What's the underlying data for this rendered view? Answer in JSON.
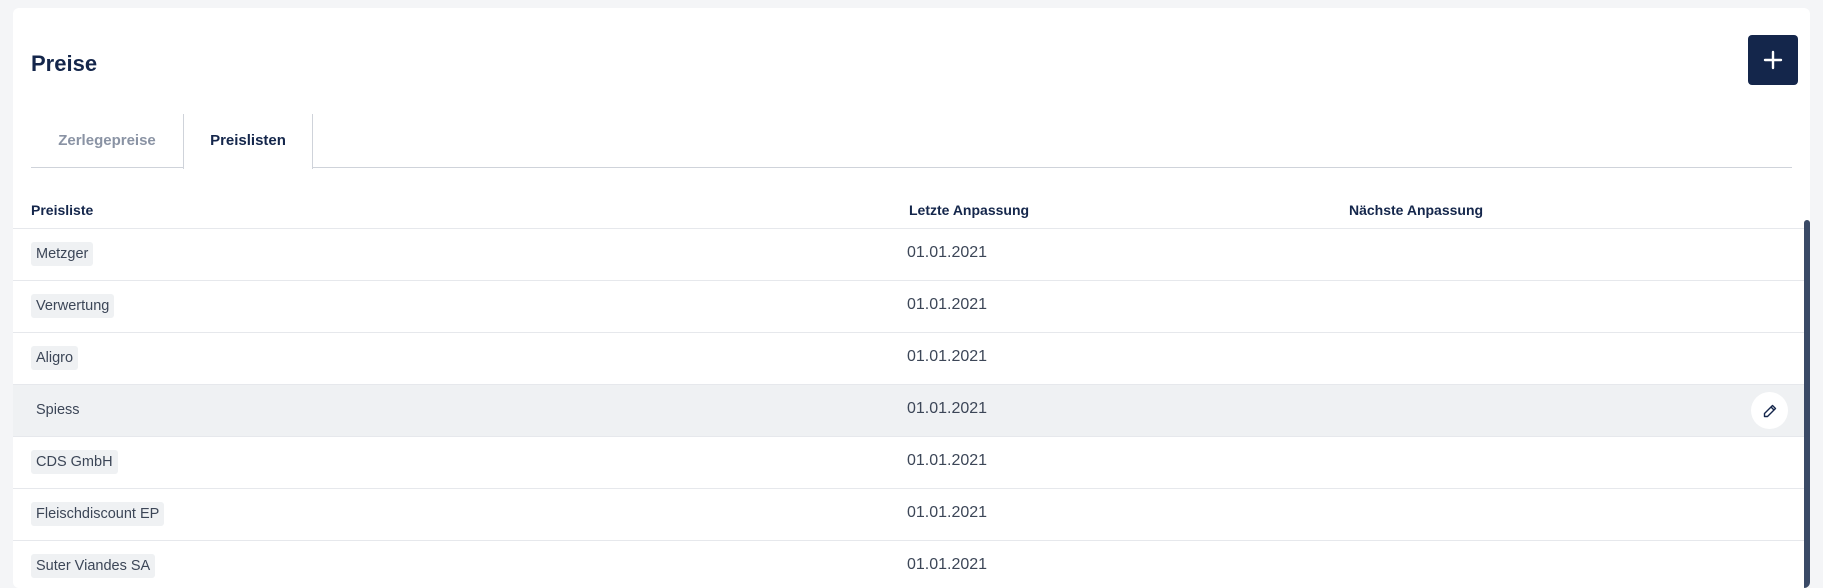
{
  "header": {
    "title": "Preise",
    "add_button_icon": "plus-icon"
  },
  "tabs": [
    {
      "label": "Zerlegepreise",
      "active": false
    },
    {
      "label": "Preislisten",
      "active": true
    }
  ],
  "table": {
    "columns": [
      "Preisliste",
      "Letzte Anpassung",
      "Nächste Anpassung"
    ],
    "rows": [
      {
        "name": "Metzger",
        "last": "01.01.2021",
        "next": ""
      },
      {
        "name": "Verwertung",
        "last": "01.01.2021",
        "next": ""
      },
      {
        "name": "Aligro",
        "last": "01.01.2021",
        "next": ""
      },
      {
        "name": "Spiess",
        "last": "01.01.2021",
        "next": "",
        "hovered": true,
        "action_icon": "pencil-icon"
      },
      {
        "name": "CDS GmbH",
        "last": "01.01.2021",
        "next": ""
      },
      {
        "name": "Fleischdiscount EP",
        "last": "01.01.2021",
        "next": ""
      },
      {
        "name": "Suter Viandes SA",
        "last": "01.01.2021",
        "next": ""
      }
    ]
  },
  "colors": {
    "primary": "#14264b",
    "hover_row": "#eff1f3",
    "tag_bg": "#eff1f3",
    "muted_text": "#8a93a4"
  }
}
